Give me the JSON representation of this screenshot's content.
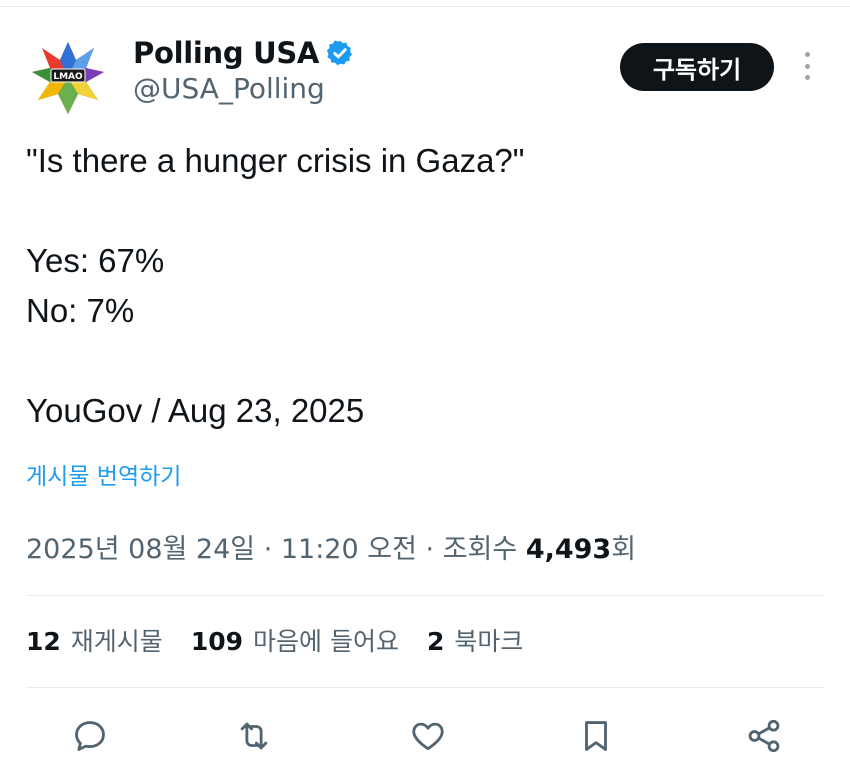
{
  "account": {
    "display_name": "Polling USA",
    "handle": "@USA_Polling",
    "avatar_text": "LMAO",
    "verified": true
  },
  "header": {
    "subscribe_label": "구독하기"
  },
  "tweet": {
    "lines": [
      "\"Is there a hunger crisis in Gaza?\"",
      "",
      "Yes: 67%",
      "No: 7%",
      "",
      "YouGov / Aug 23, 2025"
    ],
    "translate_label": "게시물 번역하기",
    "timestamp": "2025년 08월 24일 · 11:20 오전 · ",
    "views_label": "조회수",
    "views_count": "4,493",
    "views_suffix": "회"
  },
  "stats": {
    "reposts_count": "12",
    "reposts_label": "재게시물",
    "likes_count": "109",
    "likes_label": "마음에 들어요",
    "bookmarks_count": "2",
    "bookmarks_label": "북마크"
  },
  "actions": [
    "reply",
    "repost",
    "like",
    "bookmark",
    "share"
  ],
  "colors": {
    "text": "#0f1419",
    "secondary": "#536471",
    "link": "#1d9bf0",
    "verified": "#1d9bf0",
    "button_bg": "#0f1419",
    "divider": "#e6ebef"
  }
}
